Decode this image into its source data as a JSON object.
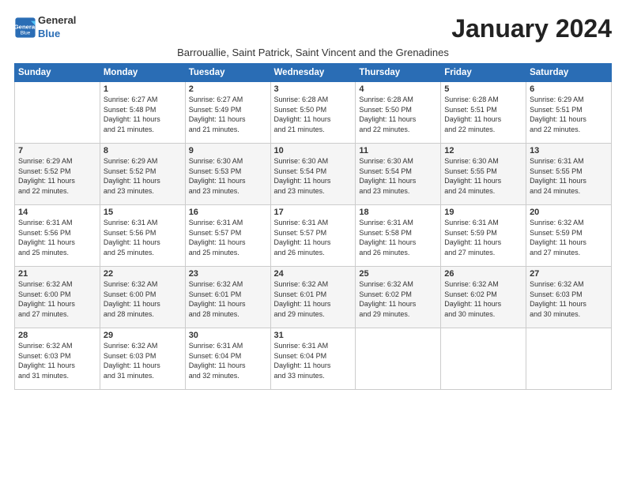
{
  "logo": {
    "line1": "General",
    "line2": "Blue"
  },
  "title": "January 2024",
  "subtitle": "Barrouallie, Saint Patrick, Saint Vincent and the Grenadines",
  "days_header": [
    "Sunday",
    "Monday",
    "Tuesday",
    "Wednesday",
    "Thursday",
    "Friday",
    "Saturday"
  ],
  "weeks": [
    [
      {
        "day": "",
        "info": ""
      },
      {
        "day": "1",
        "info": "Sunrise: 6:27 AM\nSunset: 5:48 PM\nDaylight: 11 hours\nand 21 minutes."
      },
      {
        "day": "2",
        "info": "Sunrise: 6:27 AM\nSunset: 5:49 PM\nDaylight: 11 hours\nand 21 minutes."
      },
      {
        "day": "3",
        "info": "Sunrise: 6:28 AM\nSunset: 5:50 PM\nDaylight: 11 hours\nand 21 minutes."
      },
      {
        "day": "4",
        "info": "Sunrise: 6:28 AM\nSunset: 5:50 PM\nDaylight: 11 hours\nand 22 minutes."
      },
      {
        "day": "5",
        "info": "Sunrise: 6:28 AM\nSunset: 5:51 PM\nDaylight: 11 hours\nand 22 minutes."
      },
      {
        "day": "6",
        "info": "Sunrise: 6:29 AM\nSunset: 5:51 PM\nDaylight: 11 hours\nand 22 minutes."
      }
    ],
    [
      {
        "day": "7",
        "info": "Sunrise: 6:29 AM\nSunset: 5:52 PM\nDaylight: 11 hours\nand 22 minutes."
      },
      {
        "day": "8",
        "info": "Sunrise: 6:29 AM\nSunset: 5:52 PM\nDaylight: 11 hours\nand 23 minutes."
      },
      {
        "day": "9",
        "info": "Sunrise: 6:30 AM\nSunset: 5:53 PM\nDaylight: 11 hours\nand 23 minutes."
      },
      {
        "day": "10",
        "info": "Sunrise: 6:30 AM\nSunset: 5:54 PM\nDaylight: 11 hours\nand 23 minutes."
      },
      {
        "day": "11",
        "info": "Sunrise: 6:30 AM\nSunset: 5:54 PM\nDaylight: 11 hours\nand 23 minutes."
      },
      {
        "day": "12",
        "info": "Sunrise: 6:30 AM\nSunset: 5:55 PM\nDaylight: 11 hours\nand 24 minutes."
      },
      {
        "day": "13",
        "info": "Sunrise: 6:31 AM\nSunset: 5:55 PM\nDaylight: 11 hours\nand 24 minutes."
      }
    ],
    [
      {
        "day": "14",
        "info": "Sunrise: 6:31 AM\nSunset: 5:56 PM\nDaylight: 11 hours\nand 25 minutes."
      },
      {
        "day": "15",
        "info": "Sunrise: 6:31 AM\nSunset: 5:56 PM\nDaylight: 11 hours\nand 25 minutes."
      },
      {
        "day": "16",
        "info": "Sunrise: 6:31 AM\nSunset: 5:57 PM\nDaylight: 11 hours\nand 25 minutes."
      },
      {
        "day": "17",
        "info": "Sunrise: 6:31 AM\nSunset: 5:57 PM\nDaylight: 11 hours\nand 26 minutes."
      },
      {
        "day": "18",
        "info": "Sunrise: 6:31 AM\nSunset: 5:58 PM\nDaylight: 11 hours\nand 26 minutes."
      },
      {
        "day": "19",
        "info": "Sunrise: 6:31 AM\nSunset: 5:59 PM\nDaylight: 11 hours\nand 27 minutes."
      },
      {
        "day": "20",
        "info": "Sunrise: 6:32 AM\nSunset: 5:59 PM\nDaylight: 11 hours\nand 27 minutes."
      }
    ],
    [
      {
        "day": "21",
        "info": "Sunrise: 6:32 AM\nSunset: 6:00 PM\nDaylight: 11 hours\nand 27 minutes."
      },
      {
        "day": "22",
        "info": "Sunrise: 6:32 AM\nSunset: 6:00 PM\nDaylight: 11 hours\nand 28 minutes."
      },
      {
        "day": "23",
        "info": "Sunrise: 6:32 AM\nSunset: 6:01 PM\nDaylight: 11 hours\nand 28 minutes."
      },
      {
        "day": "24",
        "info": "Sunrise: 6:32 AM\nSunset: 6:01 PM\nDaylight: 11 hours\nand 29 minutes."
      },
      {
        "day": "25",
        "info": "Sunrise: 6:32 AM\nSunset: 6:02 PM\nDaylight: 11 hours\nand 29 minutes."
      },
      {
        "day": "26",
        "info": "Sunrise: 6:32 AM\nSunset: 6:02 PM\nDaylight: 11 hours\nand 30 minutes."
      },
      {
        "day": "27",
        "info": "Sunrise: 6:32 AM\nSunset: 6:03 PM\nDaylight: 11 hours\nand 30 minutes."
      }
    ],
    [
      {
        "day": "28",
        "info": "Sunrise: 6:32 AM\nSunset: 6:03 PM\nDaylight: 11 hours\nand 31 minutes."
      },
      {
        "day": "29",
        "info": "Sunrise: 6:32 AM\nSunset: 6:03 PM\nDaylight: 11 hours\nand 31 minutes."
      },
      {
        "day": "30",
        "info": "Sunrise: 6:31 AM\nSunset: 6:04 PM\nDaylight: 11 hours\nand 32 minutes."
      },
      {
        "day": "31",
        "info": "Sunrise: 6:31 AM\nSunset: 6:04 PM\nDaylight: 11 hours\nand 33 minutes."
      },
      {
        "day": "",
        "info": ""
      },
      {
        "day": "",
        "info": ""
      },
      {
        "day": "",
        "info": ""
      }
    ]
  ]
}
